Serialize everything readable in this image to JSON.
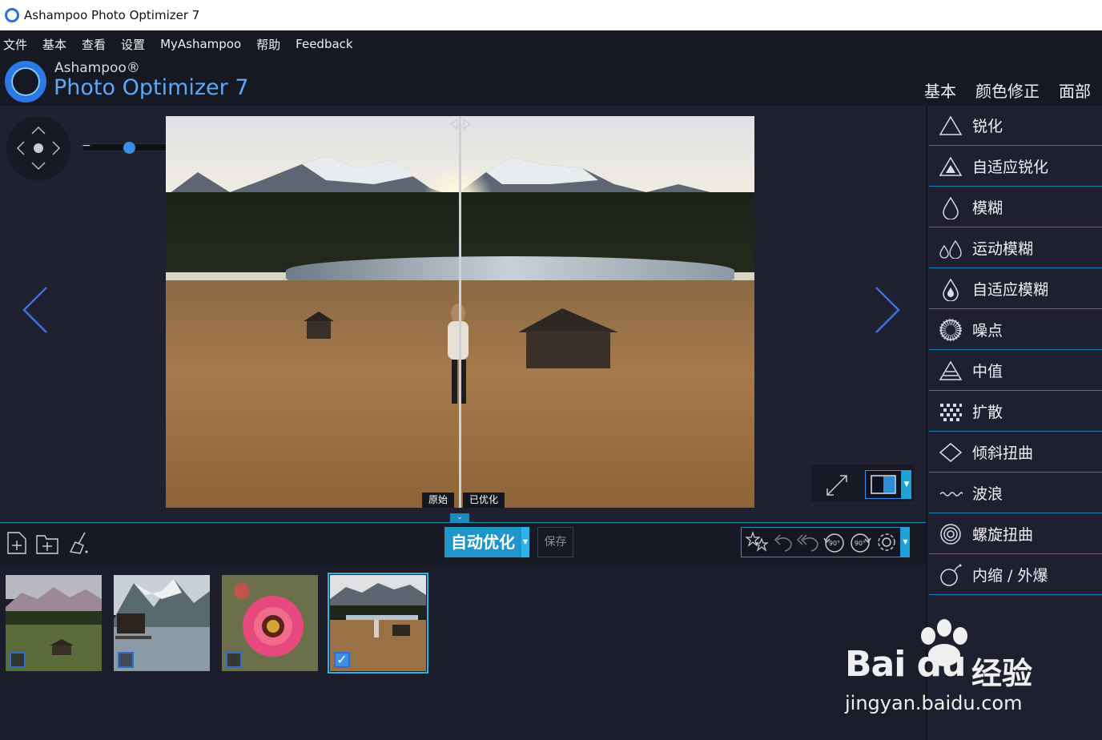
{
  "window": {
    "title": "Ashampoo Photo Optimizer 7"
  },
  "menu": [
    "文件",
    "基本",
    "查看",
    "设置",
    "MyAshampoo",
    "帮助",
    "Feedback"
  ],
  "brand": {
    "small": "Ashampoo®",
    "big": "Photo Optimizer 7"
  },
  "header_tabs": [
    "基本",
    "颜色修正",
    "面部"
  ],
  "viewer": {
    "zoom": {
      "minus": "−",
      "plus": "+",
      "level": 0.35
    },
    "labels": {
      "original": "原始",
      "optimized": "已优化"
    }
  },
  "toolbar": {
    "auto_optimize": "自动优化",
    "save": "保存"
  },
  "thumbnails": [
    {
      "name": "mountain-meadow",
      "checked": false
    },
    {
      "name": "lake-village",
      "checked": false
    },
    {
      "name": "pink-flower",
      "checked": false
    },
    {
      "name": "field-girl",
      "checked": true,
      "check_glyph": "✓"
    }
  ],
  "sidebar": [
    {
      "label": "锐化",
      "icon": "triangle-icon"
    },
    {
      "label": "自适应锐化",
      "icon": "triangle-adaptive-icon"
    },
    {
      "label": "模糊",
      "icon": "drop-icon"
    },
    {
      "label": "运动模糊",
      "icon": "motion-drops-icon"
    },
    {
      "label": "自适应模糊",
      "icon": "drop-adaptive-icon"
    },
    {
      "label": "噪点",
      "icon": "noise-icon"
    },
    {
      "label": "中值",
      "icon": "median-icon"
    },
    {
      "label": "扩散",
      "icon": "diffuse-icon"
    },
    {
      "label": "倾斜扭曲",
      "icon": "diamond-icon"
    },
    {
      "label": "波浪",
      "icon": "wave-icon"
    },
    {
      "label": "螺旋扭曲",
      "icon": "spiral-icon"
    },
    {
      "label": "内缩 / 外爆",
      "icon": "bomb-icon"
    }
  ],
  "watermark": {
    "brand": "Bai du",
    "jy": "经验",
    "url": "jingyan.baidu.com"
  },
  "colors": {
    "accent": "#1f95c9",
    "bg": "#1b1d2a",
    "panel": "#1e2030"
  }
}
